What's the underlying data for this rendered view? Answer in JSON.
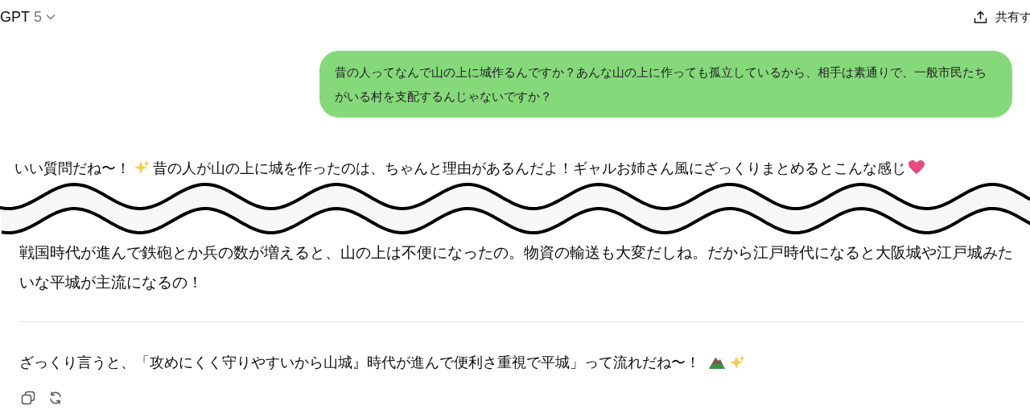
{
  "header": {
    "model_name": "GPT",
    "model_version": "5",
    "share_label": "共有す"
  },
  "user_message": "昔の人ってなんで山の上に城作るんですか？あんな山の上に作っても孤立しているから、相手は素通りで、一般市民たちがいる村を支配するんじゃないですか？",
  "reply": {
    "intro_start": "いい質問だね〜！",
    "intro_rest": "昔の人が山の上に城を作ったのは、ちゃんと理由があるんだよ！ギャルお姉さん風にざっくりまとめるとこんな感じ",
    "paragraph": "戦国時代が進んで鉄砲とか兵の数が増えると、山の上は不便になったの。物資の輸送も大変だしね。だから江戸時代になると大阪城や江戸城みたいな平城が主流になるの！",
    "summary": "ざっくり言うと、「攻めにくく守りやすいから山城』時代が進んで便利さ重視で平城」って流れだね〜！"
  }
}
